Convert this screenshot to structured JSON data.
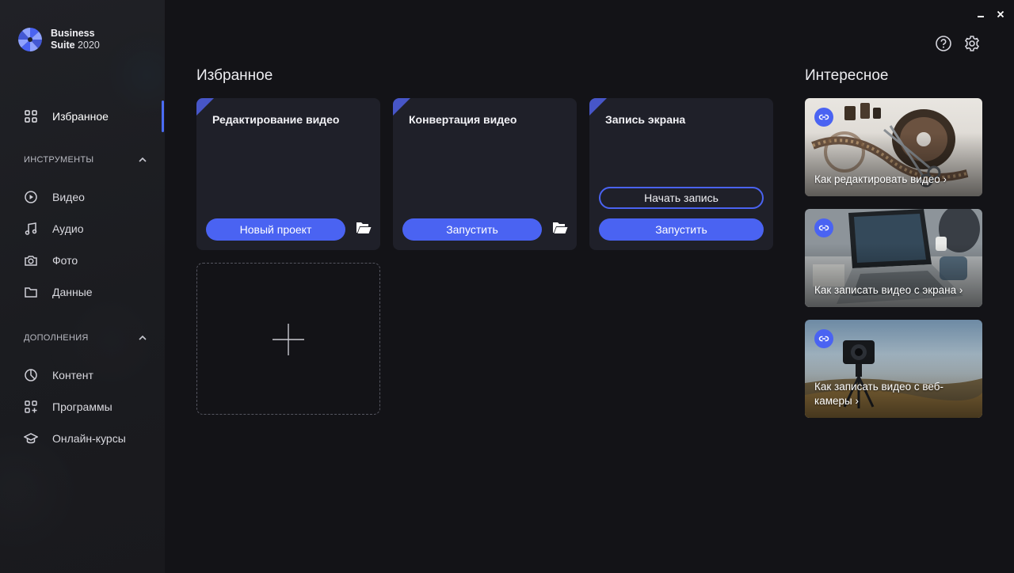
{
  "app": {
    "logo_line1": "Business",
    "logo_line2": "Suite",
    "logo_year": "2020"
  },
  "sidebar": {
    "favorites_label": "Избранное",
    "tools_section": "ИНСТРУМЕНТЫ",
    "tools": [
      {
        "label": "Видео",
        "icon": "play-circle-icon"
      },
      {
        "label": "Аудио",
        "icon": "music-note-icon"
      },
      {
        "label": "Фото",
        "icon": "camera-icon"
      },
      {
        "label": "Данные",
        "icon": "folder-icon"
      }
    ],
    "addons_section": "ДОПОЛНЕНИЯ",
    "addons": [
      {
        "label": "Контент",
        "icon": "pie-chart-icon"
      },
      {
        "label": "Программы",
        "icon": "apps-add-icon"
      },
      {
        "label": "Онлайн-курсы",
        "icon": "graduation-cap-icon"
      }
    ]
  },
  "favorites": {
    "title": "Избранное",
    "cards": [
      {
        "title": "Редактирование видео",
        "primary": "Новый проект",
        "has_folder": true
      },
      {
        "title": "Конвертация видео",
        "primary": "Запустить",
        "has_folder": true
      },
      {
        "title": "Запись экрана",
        "secondary": "Начать запись",
        "primary": "Запустить",
        "has_folder": false
      }
    ]
  },
  "interesting": {
    "title": "Интересное",
    "tiles": [
      {
        "label": "Как редактировать видео ›"
      },
      {
        "label": "Как записать видео с экрана ›"
      },
      {
        "label": "Как записать видео с веб-камеры ›"
      }
    ]
  },
  "colors": {
    "accent": "#4a63f2",
    "background": "#131317",
    "card": "#1f2029",
    "sidebar": "#1d1e22"
  }
}
